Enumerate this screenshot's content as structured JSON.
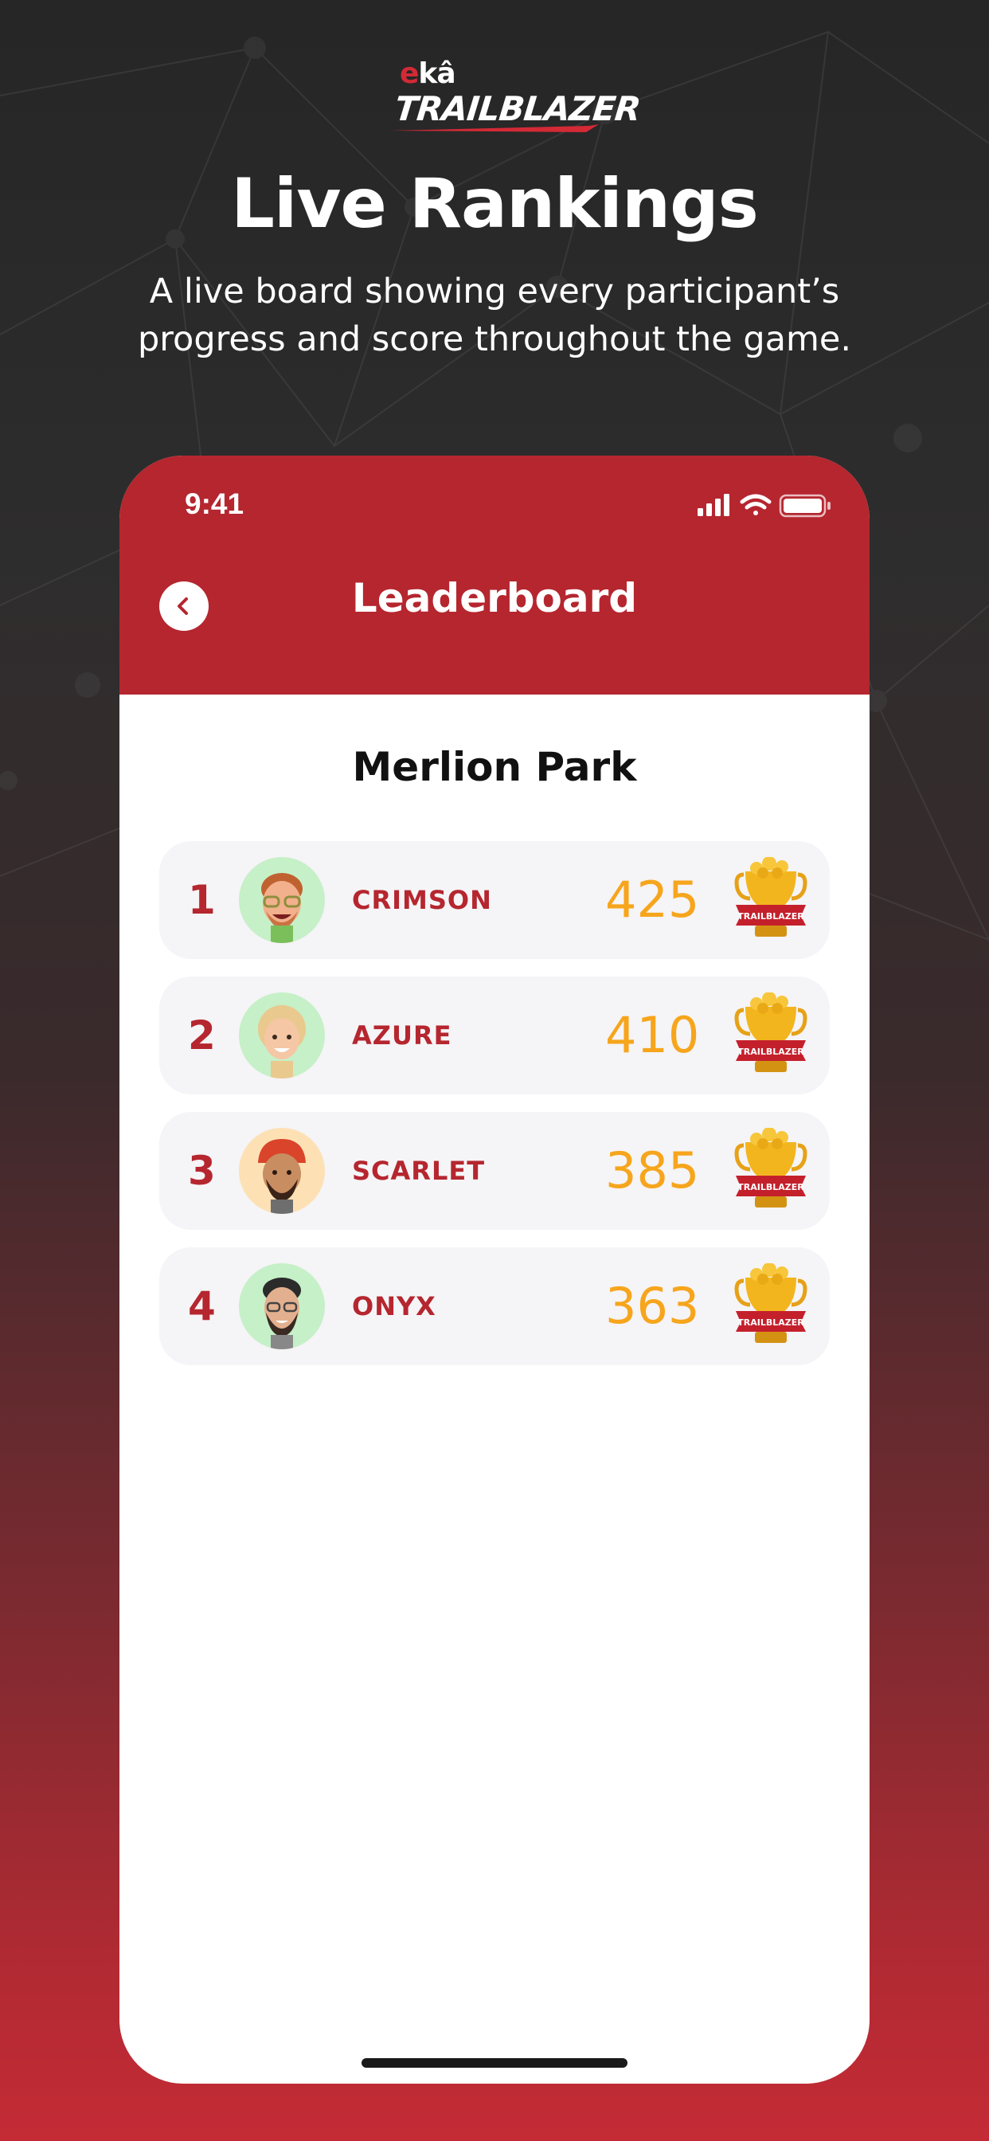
{
  "brand": {
    "eka_e": "e",
    "eka_ka": "kâ",
    "trailblazer": "TRAILBLAZER"
  },
  "headline": "Live Rankings",
  "subheadline": "A live board showing every participant’s progress and score throughout the game.",
  "status_bar": {
    "time": "9:41"
  },
  "nav": {
    "title": "Leaderboard"
  },
  "park": {
    "name": "Merlion Park"
  },
  "rankings": [
    {
      "rank": "1",
      "name": "CRIMSON",
      "score": "425",
      "avatar_bg": "#c6f0c8"
    },
    {
      "rank": "2",
      "name": "AZURE",
      "score": "410",
      "avatar_bg": "#c6f0c8"
    },
    {
      "rank": "3",
      "name": "SCARLET",
      "score": "385",
      "avatar_bg": "#fde1b4"
    },
    {
      "rank": "4",
      "name": "ONYX",
      "score": "363",
      "avatar_bg": "#c6f0c8"
    }
  ],
  "trophy_label": "TRAILBLAZER",
  "colors": {
    "accent": "#b5262f",
    "score": "#f6a51c",
    "card": "#f5f4f6"
  }
}
